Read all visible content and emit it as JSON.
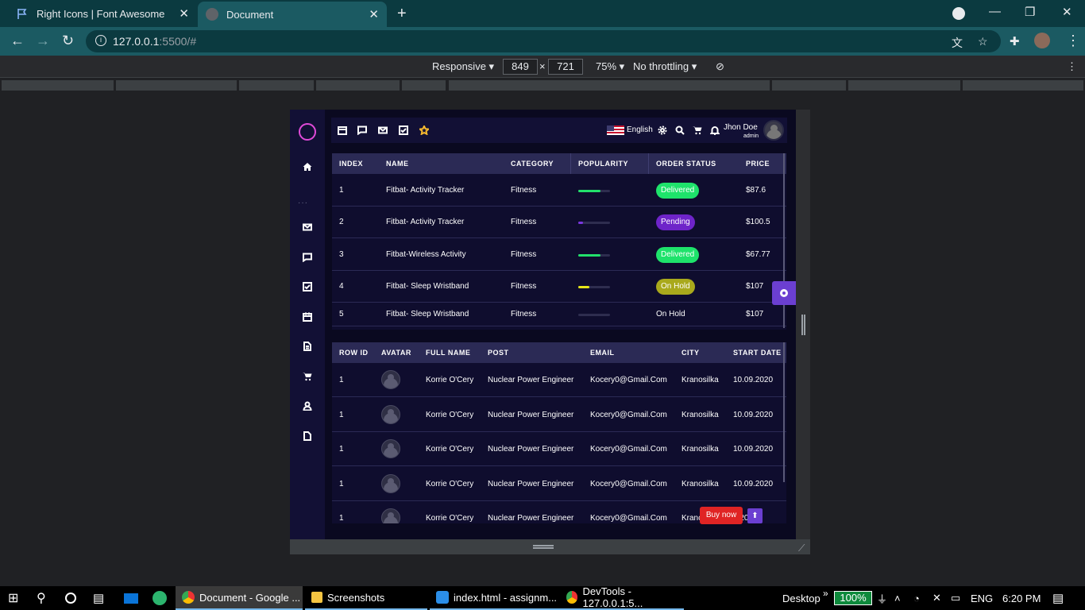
{
  "browser": {
    "tabs": [
      {
        "title": "Right Icons | Font Awesome"
      },
      {
        "title": "Document"
      }
    ],
    "url_host": "127.0.0.1",
    "url_rest": ":5500/#"
  },
  "devtools": {
    "device": "Responsive",
    "width": "849",
    "height": "721",
    "zoom": "75%",
    "throttling": "No throttling"
  },
  "topnav": {
    "language": "English",
    "user_name": "Jhon Doe",
    "user_role": "admin"
  },
  "orders_table": {
    "headers": [
      "INDEX",
      "NAME",
      "CATEGORY",
      "POPULARITY",
      "ORDER STATUS",
      "PRICE"
    ],
    "rows": [
      {
        "index": "1",
        "name": "Fitbat- Activity Tracker",
        "category": "Fitness",
        "popularity": 0.7,
        "popularity_color": "#22e06b",
        "status": "Delivered",
        "status_color": "#1ee36b",
        "price": "$87.6"
      },
      {
        "index": "2",
        "name": "Fitbat- Activity Tracker",
        "category": "Fitness",
        "popularity": 0.15,
        "popularity_color": "#7a36e0",
        "status": "Pending",
        "status_color": "#6e24c9",
        "price": "$100.5"
      },
      {
        "index": "3",
        "name": "Fitbat-Wireless Activity",
        "category": "Fitness",
        "popularity": 0.7,
        "popularity_color": "#22e06b",
        "status": "Delivered",
        "status_color": "#1ee36b",
        "price": "$67.77"
      },
      {
        "index": "4",
        "name": "Fitbat- Sleep Wristband",
        "category": "Fitness",
        "popularity": 0.35,
        "popularity_color": "#e6e619",
        "status": "On Hold",
        "status_color": "#a9a91c",
        "price": "$107"
      },
      {
        "index": "5",
        "name": "Fitbat- Sleep Wristband",
        "category": "Fitness",
        "popularity": 0,
        "popularity_color": "#2e2d4f",
        "status": "On Hold",
        "status_color": "",
        "price": "$107"
      }
    ]
  },
  "people_table": {
    "headers": [
      "ROW ID",
      "AVATAR",
      "FULL NAME",
      "POST",
      "EMAIL",
      "CITY",
      "START DATE"
    ],
    "rows": [
      {
        "id": "1",
        "full_name": "Korrie O'Cery",
        "post": "Nuclear Power Engineer",
        "email": "Kocery0@Gmail.Com",
        "city": "Kranosilka",
        "start": "10.09.2020"
      },
      {
        "id": "1",
        "full_name": "Korrie O'Cery",
        "post": "Nuclear Power Engineer",
        "email": "Kocery0@Gmail.Com",
        "city": "Kranosilka",
        "start": "10.09.2020"
      },
      {
        "id": "1",
        "full_name": "Korrie O'Cery",
        "post": "Nuclear Power Engineer",
        "email": "Kocery0@Gmail.Com",
        "city": "Kranosilka",
        "start": "10.09.2020"
      },
      {
        "id": "1",
        "full_name": "Korrie O'Cery",
        "post": "Nuclear Power Engineer",
        "email": "Kocery0@Gmail.Com",
        "city": "Kranosilka",
        "start": "10.09.2020"
      },
      {
        "id": "1",
        "full_name": "Korrie O'Cery",
        "post": "Nuclear Power Engineer",
        "email": "Kocery0@Gmail.Com",
        "city": "Kranc",
        "start": "0.2020"
      }
    ]
  },
  "buttons": {
    "buy_now": "Buy now"
  },
  "taskbar": {
    "apps": [
      {
        "label": "Document - Google ..."
      },
      {
        "label": "Screenshots"
      },
      {
        "label": "index.html - assignm..."
      },
      {
        "label": "DevTools - 127.0.0.1:5..."
      }
    ],
    "desktop": "Desktop",
    "battery": "100%",
    "lang": "ENG",
    "time": "6:20 PM"
  }
}
